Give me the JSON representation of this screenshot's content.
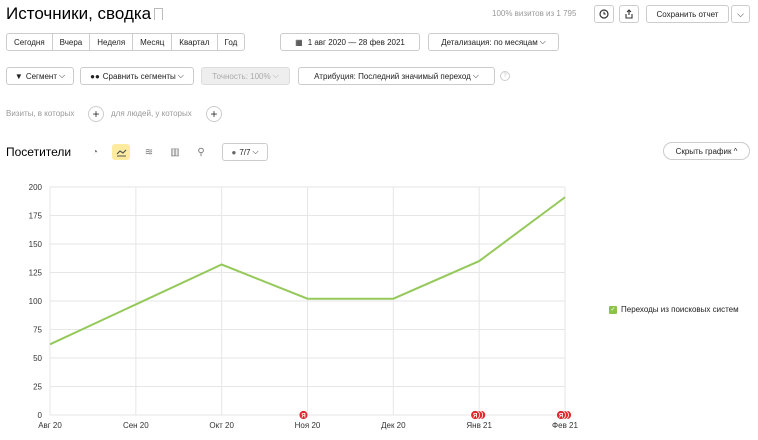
{
  "header": {
    "title": "Источники, сводка",
    "visits_note": "100% визитов из 1 795",
    "save_report": "Сохранить отчет",
    "dropdown_arrow": "⌵"
  },
  "periods": [
    "Сегодня",
    "Вчера",
    "Неделя",
    "Месяц",
    "Квартал",
    "Год"
  ],
  "date_range": "1 авг 2020 — 28 фев 2021",
  "detail": "Детализация: по месяцам",
  "segment": "Сегмент",
  "compare": "Сравнить сегменты",
  "accuracy": "Точность: 100%",
  "attribution": "Атрибуция: Последний значимый переход",
  "help_mark": "?",
  "filters": {
    "visits_label": "Визиты, в которых",
    "people_label": "для людей, у которых",
    "plus": "+"
  },
  "section": {
    "title": "Посетители",
    "series_count": "7/7",
    "hide_chart": "Скрыть график ^"
  },
  "icons": {
    "bookmark": "bookmark-icon",
    "clock": "clock-icon",
    "export": "export-icon",
    "pie": "pie-chart-icon",
    "line": "line-chart-icon",
    "area": "area-chart-icon",
    "bar": "bar-chart-icon",
    "map": "map-pin-icon"
  },
  "colors": {
    "line": "#95c95b",
    "active_tool": "#ffeba0",
    "marker": "#e0282e",
    "legend_check": "#8bc34a"
  },
  "chart_data": {
    "type": "line",
    "categories": [
      "Авг 20",
      "Сен 20",
      "Окт 20",
      "Ноя 20",
      "Дек 20",
      "Янв 21",
      "Фев 21"
    ],
    "series": [
      {
        "name": "Переходы из поисковых систем",
        "values": [
          62,
          97,
          132,
          102,
          102,
          135,
          191
        ]
      }
    ],
    "yticks": [
      0,
      25,
      50,
      75,
      100,
      125,
      150,
      175,
      200
    ],
    "ylim": [
      0,
      200
    ],
    "grid": true,
    "legend": "right",
    "markers": [
      {
        "category": "Ноя 20",
        "label": "Я",
        "count": 1
      },
      {
        "category": "Янв 21",
        "label": "Я",
        "count": 3
      },
      {
        "category": "Фев 21",
        "label": "Я",
        "count": 3
      }
    ]
  }
}
